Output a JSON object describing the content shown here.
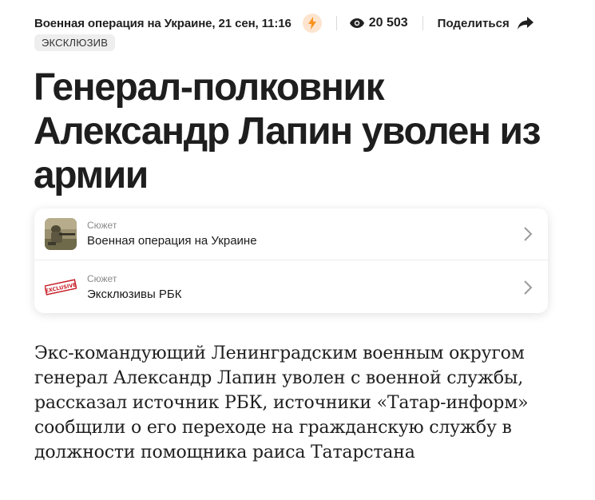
{
  "meta": {
    "category_date": "Военная операция на Украине, 21 сен, 11:16",
    "views": "20 503",
    "share_label": "Поделиться",
    "accent_color": "#f7931e"
  },
  "badge": "ЭКСКЛЮЗИВ",
  "headline": "Генерал-полковник Александр Лапин уволен из армии",
  "stories": [
    {
      "kicker": "Сюжет",
      "title": "Военная операция на Украине",
      "thumb": "soldier-photo"
    },
    {
      "kicker": "Сюжет",
      "title": "Эксклюзивы РБК",
      "thumb": "exclusive-stamp"
    }
  ],
  "stamp_text": "EXCLUSIVE",
  "lede": "Экс-командующий Ленинградским военным округом генерал Александр Лапин уволен с военной службы, рассказал источник РБК, источники «Татар-информ» сообщили о его переходе на гражданскую службу в должности помощника раиса Татарстана"
}
